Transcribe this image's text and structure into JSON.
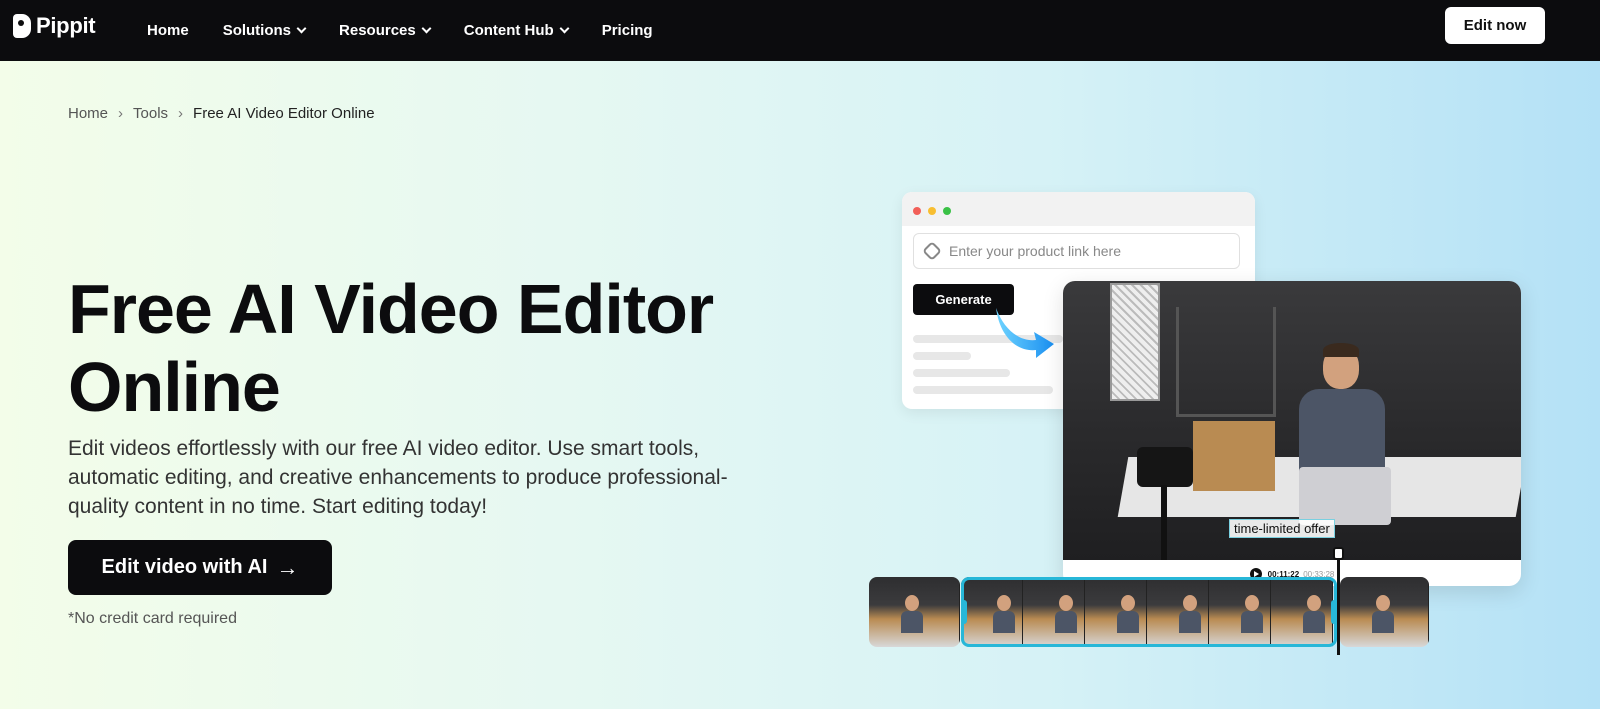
{
  "brand": {
    "name": "Pippit"
  },
  "nav": {
    "items": [
      {
        "label": "Home"
      },
      {
        "label": "Solutions"
      },
      {
        "label": "Resources"
      },
      {
        "label": "Content Hub"
      },
      {
        "label": "Pricing"
      }
    ],
    "edit_now": "Edit now"
  },
  "breadcrumb": {
    "home": "Home",
    "tools": "Tools",
    "current": "Free AI Video Editor Online"
  },
  "hero": {
    "title": "Free AI Video Editor Online",
    "description": "Edit videos effortlessly with our free AI video editor. Use smart tools, automatic editing, and creative enhancements to produce professional-quality content in no time. Start editing today!",
    "cta": "Edit video with AI",
    "cta_icon": "→",
    "note": "*No credit card required"
  },
  "mockup": {
    "url_placeholder": "Enter your product link here",
    "generate": "Generate",
    "caption": "time-limited offer",
    "timecode": "00:11:22",
    "duration": "00:33:28",
    "dot_colors": [
      "#f25f58",
      "#f8be31",
      "#3ac146"
    ],
    "accent": "#27b7d8"
  }
}
